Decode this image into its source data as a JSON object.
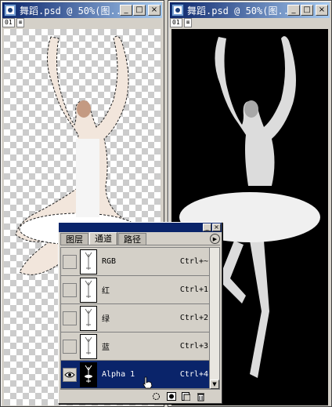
{
  "windows": {
    "left": {
      "title": "舞蹈.psd @ 50%(图...",
      "tags": [
        "01",
        "⌧"
      ]
    },
    "right": {
      "title": "舞蹈.psd @ 50%(图...",
      "tags": [
        "01",
        "⌧"
      ]
    },
    "buttons": {
      "minimize": "_",
      "maximize": "□",
      "close": "×"
    }
  },
  "palette": {
    "tabs": [
      {
        "label": "图层",
        "active": false
      },
      {
        "label": "通道",
        "active": true
      },
      {
        "label": "路径",
        "active": false
      }
    ],
    "menu_icon": "▶",
    "channels": [
      {
        "name": "RGB",
        "shortcut": "Ctrl+~",
        "visible": false,
        "selected": false
      },
      {
        "name": "红",
        "shortcut": "Ctrl+1",
        "visible": false,
        "selected": false
      },
      {
        "name": "绿",
        "shortcut": "Ctrl+2",
        "visible": false,
        "selected": false
      },
      {
        "name": "蓝",
        "shortcut": "Ctrl+3",
        "visible": false,
        "selected": false
      },
      {
        "name": "Alpha 1",
        "shortcut": "Ctrl+4",
        "visible": true,
        "selected": true
      }
    ],
    "bottom_icons": [
      "load-selection-icon",
      "save-selection-icon",
      "new-channel-icon",
      "delete-channel-icon"
    ]
  },
  "colors": {
    "title_active": "#0a246a",
    "selection": "#0a246a",
    "chrome": "#d4d0c8"
  }
}
